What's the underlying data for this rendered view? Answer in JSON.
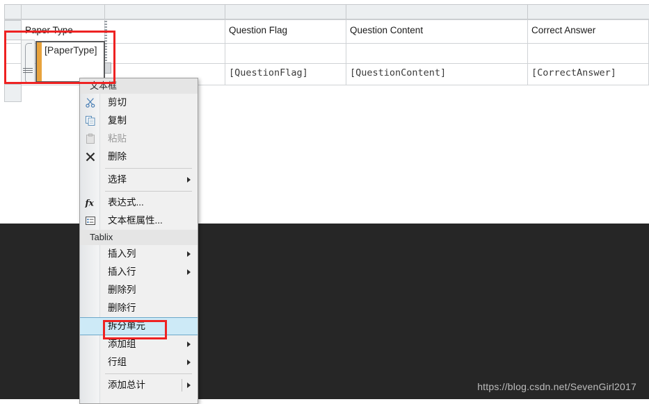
{
  "designer": {
    "columns_header_strip": "column-handles",
    "table": {
      "header_row": [
        {
          "label": "Paper Type"
        },
        {
          "label": ""
        },
        {
          "label": "Question Flag"
        },
        {
          "label": "Question Content"
        },
        {
          "label": "Correct Answer"
        }
      ],
      "data_row": [
        {
          "label": "[PaperType]"
        },
        {
          "label": ""
        },
        {
          "label": "[QuestionFlag]"
        },
        {
          "label": "[QuestionContent]"
        },
        {
          "label": "[CorrectAnswer]"
        }
      ]
    },
    "selected_textbox_value": "[PaperType]"
  },
  "context_menu": {
    "section_textbox": "文本框",
    "section_tablix": "Tablix",
    "items_textbox": [
      {
        "label": "剪切",
        "icon": "scissors-icon",
        "disabled": false,
        "submenu": false
      },
      {
        "label": "复制",
        "icon": "copy-icon",
        "disabled": false,
        "submenu": false
      },
      {
        "label": "粘贴",
        "icon": "paste-icon",
        "disabled": true,
        "submenu": false
      },
      {
        "label": "删除",
        "icon": "delete-x-icon",
        "disabled": false,
        "submenu": false
      },
      {
        "label": "选择",
        "icon": "",
        "disabled": false,
        "submenu": true
      },
      {
        "label": "表达式...",
        "icon": "fx-icon",
        "disabled": false,
        "submenu": false
      },
      {
        "label": "文本框属性...",
        "icon": "properties-icon",
        "disabled": false,
        "submenu": false
      }
    ],
    "items_tablix": [
      {
        "label": "插入列",
        "disabled": false,
        "submenu": true,
        "highlighted": false
      },
      {
        "label": "插入行",
        "disabled": false,
        "submenu": true,
        "highlighted": false
      },
      {
        "label": "删除列",
        "disabled": false,
        "submenu": false,
        "highlighted": false
      },
      {
        "label": "删除行",
        "disabled": false,
        "submenu": false,
        "highlighted": false
      },
      {
        "label": "拆分单元",
        "disabled": false,
        "submenu": false,
        "highlighted": true
      },
      {
        "label": "添加组",
        "disabled": false,
        "submenu": true,
        "highlighted": false
      },
      {
        "label": "行组",
        "disabled": false,
        "submenu": true,
        "highlighted": false
      },
      {
        "label": "添加总计",
        "disabled": false,
        "submenu": true,
        "highlighted": false,
        "split": true
      }
    ]
  },
  "annotations": {
    "cell_box_color": "#ee2222",
    "menu_item_box_color": "#ee2222"
  },
  "watermark": {
    "text": "https://blog.csdn.net/SevenGirl2017"
  },
  "colors": {
    "backdrop": "#262626",
    "selection_orange": "#e8a33d",
    "highlight_blue": "#cdeaf7",
    "grid_line": "#cfd2d5"
  }
}
